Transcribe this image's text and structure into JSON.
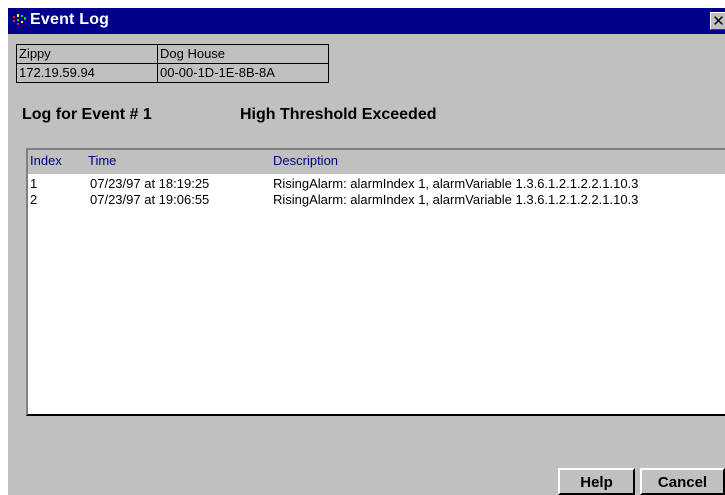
{
  "window": {
    "title": "Event Log",
    "close_symbol": "✕"
  },
  "device": {
    "name": "Zippy",
    "location": "Dog House",
    "ip": "172.19.59.94",
    "mac": "00-00-1D-1E-8B-8A"
  },
  "event": {
    "label": "Log for Event # 1",
    "description": "High Threshold Exceeded"
  },
  "log_table": {
    "columns": [
      "Index",
      "Time",
      "Description"
    ],
    "rows": [
      {
        "index": "1",
        "time": "07/23/97 at 18:19:25",
        "description": "RisingAlarm: alarmIndex 1, alarmVariable 1.3.6.1.2.1.2.2.1.10.3"
      },
      {
        "index": "2",
        "time": "07/23/97 at 19:06:55",
        "description": "RisingAlarm: alarmIndex 1, alarmVariable 1.3.6.1.2.1.2.2.1.10.3"
      }
    ]
  },
  "buttons": {
    "help": "Help",
    "cancel": "Cancel"
  },
  "icons": {
    "app": "event-log-app-icon",
    "close": "close-icon"
  },
  "colors": {
    "titlebar": "#00008b",
    "dialog": "#c0c0c0",
    "header_text": "#000080"
  }
}
